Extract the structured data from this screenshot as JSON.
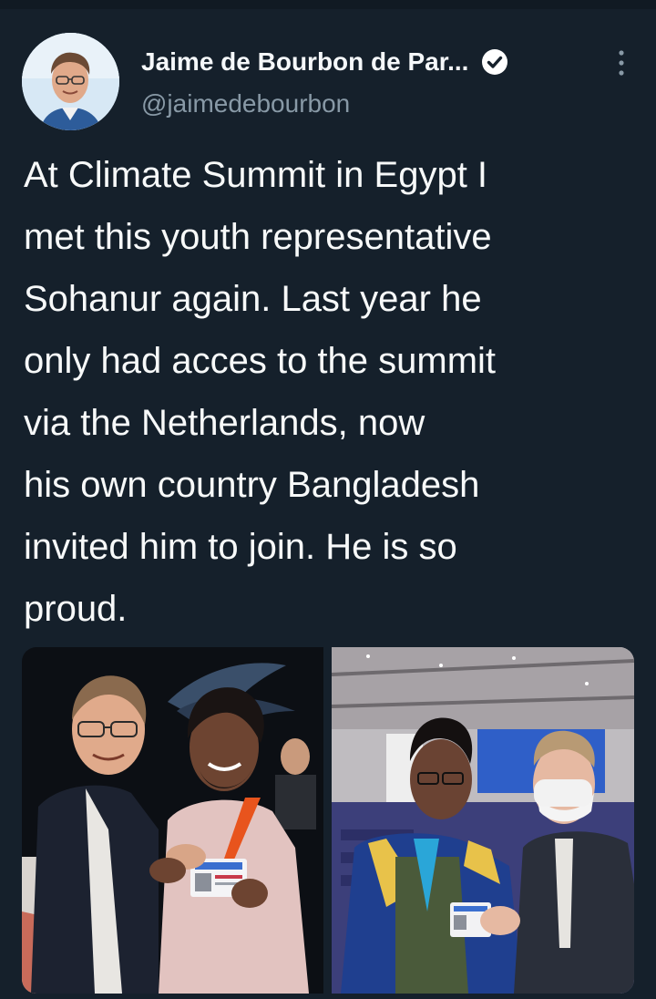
{
  "tweet": {
    "author_name": "Jaime de Bourbon de Par...",
    "author_handle": "@jaimedebourbon",
    "text_lines": [
      "At Climate Summit in Egypt I",
      "met this youth representative",
      "Sohanur again. Last year he",
      "only had acces to the summit",
      "via the Netherlands, now",
      "his own country Bangladesh",
      "invited him to join. He is so",
      "proud."
    ]
  },
  "icons": {
    "verified": "verified-badge-icon",
    "more": "more-vertical-icon"
  },
  "colors": {
    "background": "#15202b",
    "secondary_text": "#8899a6",
    "primary_text": "#f7f9f9"
  }
}
